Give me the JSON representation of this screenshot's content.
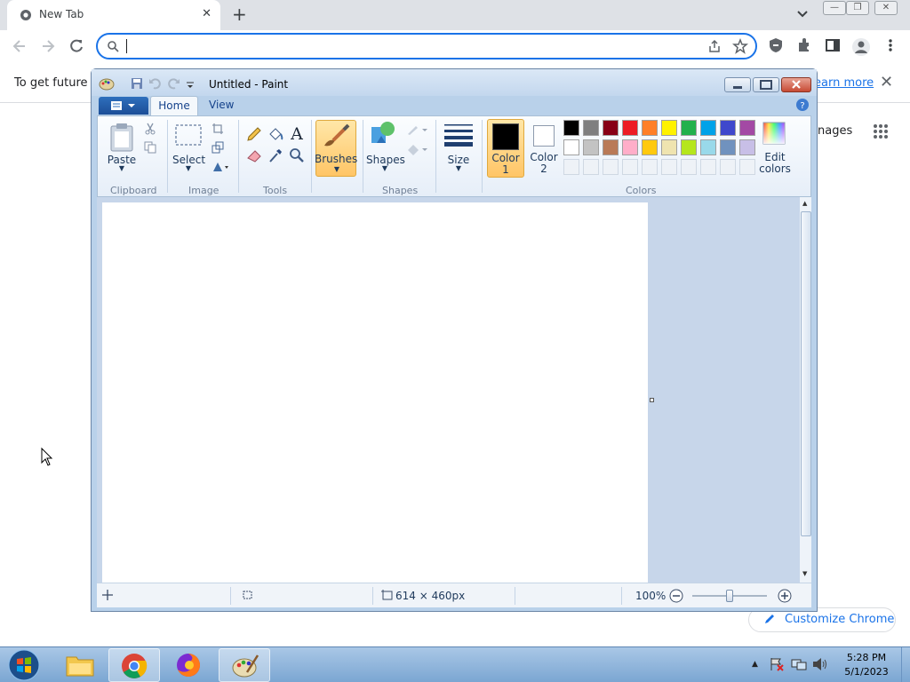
{
  "browser": {
    "tab_title": "New Tab",
    "omnibox_value": "",
    "infobar_text": "To get future G",
    "learn_more": "earn more",
    "images_link": "nages",
    "customize_label": "Customize Chrome"
  },
  "paint": {
    "title": "Untitled - Paint",
    "tabs": {
      "home": "Home",
      "view": "View"
    },
    "buttons": {
      "paste": "Paste",
      "select": "Select",
      "brushes": "Brushes",
      "shapes": "Shapes",
      "size": "Size",
      "color1_a": "Color",
      "color1_b": "1",
      "color2_a": "Color",
      "color2_b": "2",
      "edit_a": "Edit",
      "edit_b": "colors"
    },
    "groups": {
      "clipboard": "Clipboard",
      "image": "Image",
      "tools": "Tools",
      "shapes": "Shapes",
      "colors": "Colors"
    },
    "palette_row1": [
      "#000000",
      "#7f7f7f",
      "#880015",
      "#ed1c24",
      "#ff7f27",
      "#fff200",
      "#22b14c",
      "#00a2e8",
      "#3f48cc",
      "#a349a4"
    ],
    "palette_row2": [
      "#ffffff",
      "#c3c3c3",
      "#b97a57",
      "#ffaec9",
      "#ffc90e",
      "#efe4b0",
      "#b5e61d",
      "#99d9ea",
      "#7092be",
      "#c8bfe7"
    ],
    "color1": "#000000",
    "color2": "#ffffff",
    "status": {
      "dimensions": "614 × 460px",
      "zoom": "100%"
    }
  },
  "taskbar": {
    "time": "5:28 PM",
    "date": "5/1/2023"
  }
}
